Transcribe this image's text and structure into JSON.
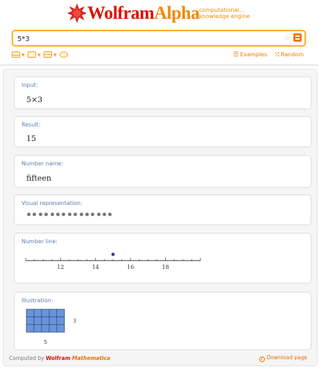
{
  "header": {
    "logo_wolfram": "Wolfram",
    "logo_alpha": "Alpha",
    "tagline_line1": "computational...",
    "tagline_line2": "knowledge engine",
    "accent_color": "#f07800",
    "brand_red": "#dd1100"
  },
  "search": {
    "value": "5*3",
    "star_icon": "star-icon",
    "go_icon": "equals-icon"
  },
  "toolbar": {
    "examples_label": "Examples",
    "random_label": "Random"
  },
  "pods": [
    {
      "title": "Input:",
      "value": "5×3"
    },
    {
      "title": "Result:",
      "value": "15"
    },
    {
      "title": "Number name:",
      "value": "fifteen"
    },
    {
      "title": "Visual representation:",
      "dot_count": 15
    },
    {
      "title": "Number line:",
      "ticks": [
        "12",
        "14",
        "16",
        "18"
      ],
      "axis_range": [
        10,
        20
      ],
      "point": 15,
      "point_color": "#3b3b9e"
    },
    {
      "title": "Illustration:",
      "grid_cols": 5,
      "grid_rows": 3,
      "width_label": "5",
      "height_label": "3",
      "fill_color": "#6b94d6"
    }
  ],
  "footer": {
    "computed_by": "Computed by",
    "wolfram": "Wolfram",
    "mathematica": "Mathematica",
    "download_label": "Download page"
  }
}
